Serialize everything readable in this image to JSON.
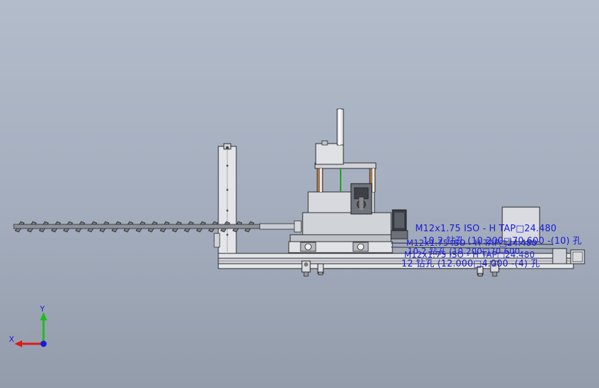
{
  "viewport": {
    "background_top": "#b3bccb",
    "background_bottom": "#939cab",
    "annotation_color": "#1a1ad6"
  },
  "annotations": {
    "hole_callout_1": "M12x1.75 ISO - H TAP□24.480",
    "hole_callout_2": "10.2 钻孔 (10.200□70.600 -(10) 孔",
    "hole_callout_3": "M12x1.75 ISO - H TAP□24.480",
    "hole_callout_4": "10.2 钻孔 (10.200□70.600",
    "hole_callout_5": "M12x1.75 ISO - H TAP□24.480",
    "hole_callout_6": "12 钻孔 (12.000□4.000 -(4) 孔"
  },
  "triad": {
    "x_label": "X",
    "y_label": "Y",
    "x_color": "#e01818",
    "y_color": "#18c018",
    "z_color": "#1818e0"
  }
}
